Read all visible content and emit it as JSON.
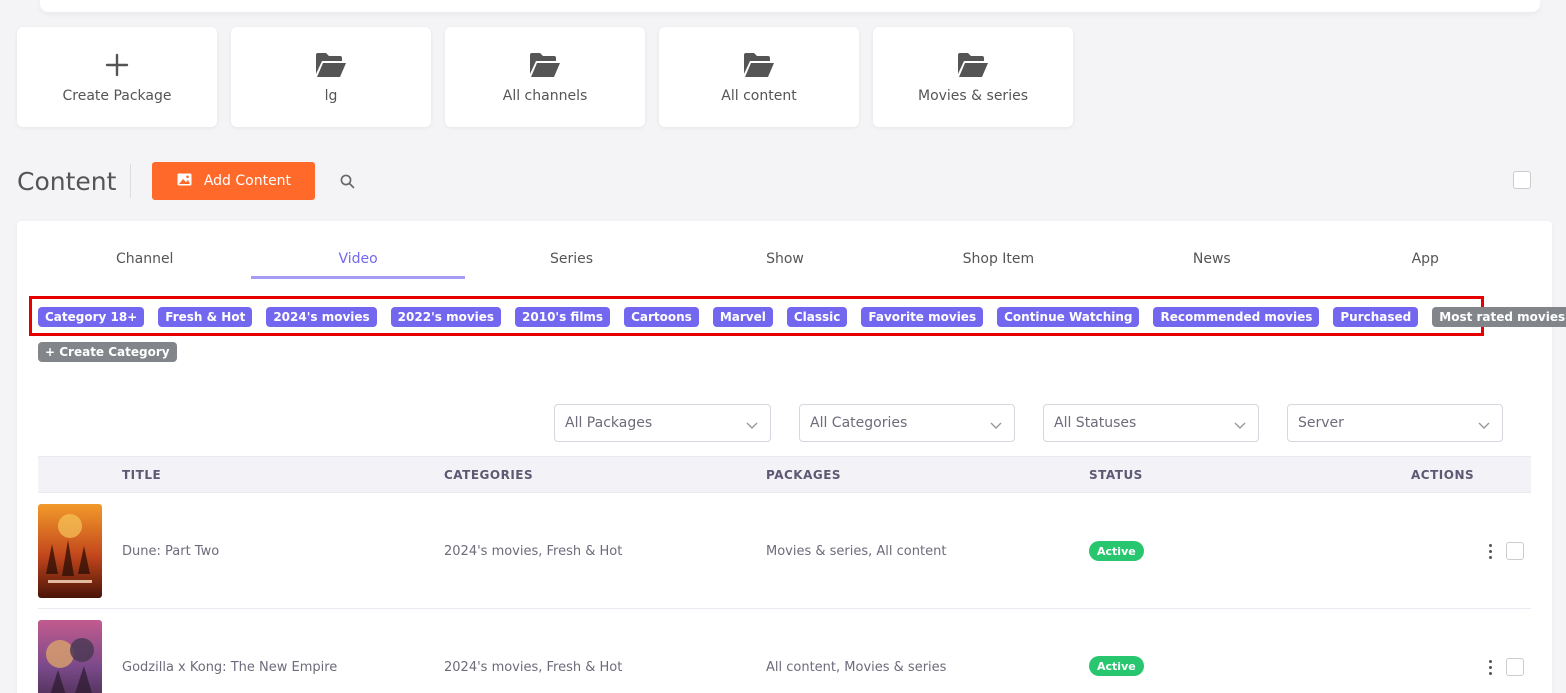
{
  "packages": [
    {
      "label": "Create Package",
      "icon": "plus-icon"
    },
    {
      "label": "lg",
      "icon": "folder-open-icon"
    },
    {
      "label": "All channels",
      "icon": "folder-open-icon"
    },
    {
      "label": "All content",
      "icon": "folder-open-icon"
    },
    {
      "label": "Movies & series",
      "icon": "folder-open-icon"
    }
  ],
  "content": {
    "title": "Content",
    "add_label": "Add Content"
  },
  "tabs": [
    "Channel",
    "Video",
    "Series",
    "Show",
    "Shop Item",
    "News",
    "App"
  ],
  "active_tab": "Video",
  "categories": [
    "Category 18+",
    "Fresh & Hot",
    "2024's movies",
    "2022's movies",
    "2010's films",
    "Cartoons",
    "Marvel",
    "Classic",
    "Favorite movies",
    "Continue Watching",
    "Recommended movies",
    "Purchased",
    "Most rated movies"
  ],
  "create_category_label": "+ Create Category",
  "filters": {
    "packages": "All Packages",
    "categories": "All Categories",
    "statuses": "All Statuses",
    "server": "Server"
  },
  "table": {
    "headers": {
      "title": "TITLE",
      "categories": "CATEGORIES",
      "packages": "PACKAGES",
      "status": "STATUS",
      "actions": "ACTIONS"
    },
    "rows": [
      {
        "title": "Dune: Part Two",
        "categories": "2024's movies, Fresh & Hot",
        "packages": "Movies & series, All content",
        "status": "Active"
      },
      {
        "title": "Godzilla x Kong: The New Empire",
        "categories": "2024's movies, Fresh & Hot",
        "packages": "All content, Movies & series",
        "status": "Active"
      }
    ]
  },
  "colors": {
    "accent": "#7367f0",
    "add_button": "#ff6a2b",
    "status_active": "#28c76f",
    "chip_gray": "#82868b",
    "highlight_box": "#e60000"
  }
}
